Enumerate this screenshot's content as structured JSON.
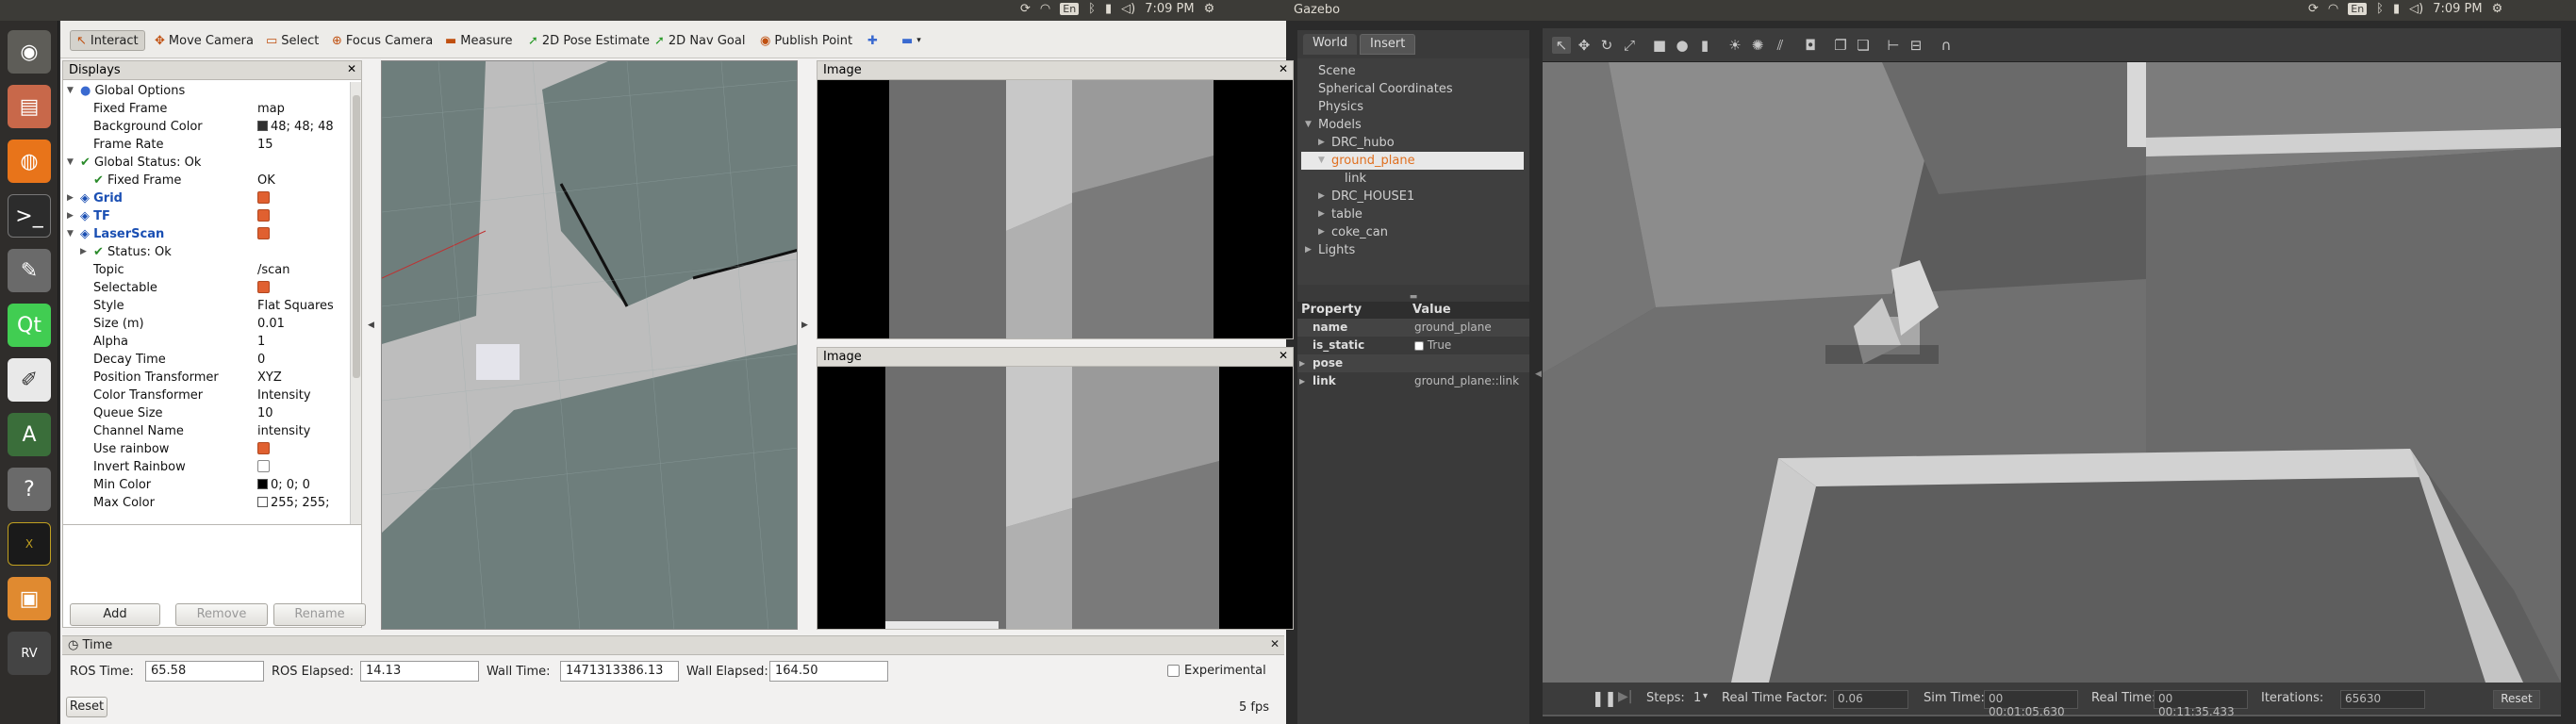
{
  "topbar": {
    "app_title": "Gazebo",
    "kb_left": "En",
    "time_left": "7:09 PM",
    "kb_right": "En",
    "time_right": "7:09 PM"
  },
  "rviz": {
    "toolbar": [
      {
        "label": "Interact",
        "icon": "interact-icon"
      },
      {
        "label": "Move Camera",
        "icon": "move-camera-icon"
      },
      {
        "label": "Select",
        "icon": "select-icon"
      },
      {
        "label": "Focus Camera",
        "icon": "focus-camera-icon"
      },
      {
        "label": "Measure",
        "icon": "measure-icon"
      },
      {
        "label": "2D Pose Estimate",
        "icon": "pose-estimate-icon"
      },
      {
        "label": "2D Nav Goal",
        "icon": "nav-goal-icon"
      },
      {
        "label": "Publish Point",
        "icon": "publish-point-icon"
      }
    ],
    "displays_title": "Displays",
    "tree": [
      {
        "label": "Global Options",
        "value": "",
        "indent": 1,
        "style": "",
        "exp": "▼"
      },
      {
        "label": "Fixed Frame",
        "value": "map",
        "indent": 2
      },
      {
        "label": "Background Color",
        "value": "48; 48; 48",
        "indent": 2,
        "swatch": "#303030"
      },
      {
        "label": "Frame Rate",
        "value": "15",
        "indent": 2
      },
      {
        "label": "Global Status: Ok",
        "value": "",
        "indent": 1,
        "exp": "▼",
        "check": true
      },
      {
        "label": "Fixed Frame",
        "value": "OK",
        "indent": 2,
        "check": true
      },
      {
        "label": "Grid",
        "value": "",
        "indent": 1,
        "exp": "▶",
        "style": "blue",
        "box": true
      },
      {
        "label": "TF",
        "value": "",
        "indent": 1,
        "exp": "▶",
        "style": "blue",
        "box": true
      },
      {
        "label": "LaserScan",
        "value": "",
        "indent": 1,
        "exp": "▼",
        "style": "blue",
        "box": true
      },
      {
        "label": "Status: Ok",
        "value": "",
        "indent": 2,
        "exp": "▶",
        "check": true
      },
      {
        "label": "Topic",
        "value": "/scan",
        "indent": 2
      },
      {
        "label": "Selectable",
        "value": "",
        "indent": 2,
        "box": true
      },
      {
        "label": "Style",
        "value": "Flat Squares",
        "indent": 2
      },
      {
        "label": "Size (m)",
        "value": "0.01",
        "indent": 2
      },
      {
        "label": "Alpha",
        "value": "1",
        "indent": 2
      },
      {
        "label": "Decay Time",
        "value": "0",
        "indent": 2
      },
      {
        "label": "Position Transformer",
        "value": "XYZ",
        "indent": 2
      },
      {
        "label": "Color Transformer",
        "value": "Intensity",
        "indent": 2
      },
      {
        "label": "Queue Size",
        "value": "10",
        "indent": 2
      },
      {
        "label": "Channel Name",
        "value": "intensity",
        "indent": 2
      },
      {
        "label": "Use rainbow",
        "value": "",
        "indent": 2,
        "box": true
      },
      {
        "label": "Invert Rainbow",
        "value": "",
        "indent": 2,
        "emptybox": true
      },
      {
        "label": "Min Color",
        "value": "0; 0; 0",
        "indent": 2,
        "swatch": "#000000"
      },
      {
        "label": "Max Color",
        "value": "255; 255;",
        "indent": 2,
        "swatch": "#ffffff"
      }
    ],
    "buttons": {
      "add": "Add",
      "remove": "Remove",
      "rename": "Rename"
    },
    "image_title_1": "Image",
    "image_title_2": "Image",
    "time": {
      "title": "Time",
      "ros_time_label": "ROS Time:",
      "ros_time": "65.58",
      "ros_elapsed_label": "ROS Elapsed:",
      "ros_elapsed": "14.13",
      "wall_time_label": "Wall Time:",
      "wall_time": "1471313386.13",
      "wall_elapsed_label": "Wall Elapsed:",
      "wall_elapsed": "164.50",
      "experimental": "Experimental",
      "reset": "Reset",
      "fps": "5 fps"
    }
  },
  "gazebo": {
    "tabs": {
      "world": "World",
      "insert": "Insert"
    },
    "tree": [
      {
        "label": "Scene",
        "indent": 1
      },
      {
        "label": "Spherical Coordinates",
        "indent": 1
      },
      {
        "label": "Physics",
        "indent": 1
      },
      {
        "label": "Models",
        "indent": 1,
        "exp": "▼"
      },
      {
        "label": "DRC_hubo",
        "indent": 2,
        "exp": "▶"
      },
      {
        "label": "ground_plane",
        "indent": 2,
        "exp": "▼",
        "selected": true
      },
      {
        "label": "link",
        "indent": 3
      },
      {
        "label": "DRC_HOUSE1",
        "indent": 2,
        "exp": "▶"
      },
      {
        "label": "table",
        "indent": 2,
        "exp": "▶"
      },
      {
        "label": "coke_can",
        "indent": 2,
        "exp": "▶"
      },
      {
        "label": "Lights",
        "indent": 1,
        "exp": "▶"
      }
    ],
    "props_header": {
      "property": "Property",
      "value": "Value"
    },
    "props": [
      {
        "name": "name",
        "value": "ground_plane"
      },
      {
        "name": "is_static",
        "value": "True",
        "check": true
      },
      {
        "name": "pose",
        "value": "",
        "exp": "▶"
      },
      {
        "name": "link",
        "value": "ground_plane::link",
        "exp": "▶"
      }
    ],
    "status": {
      "steps_label": "Steps:",
      "steps": "1",
      "rtf_label": "Real Time Factor:",
      "rtf": "0.06",
      "sim_label": "Sim Time:",
      "sim": "00 00:01:05.630",
      "real_label": "Real Time:",
      "real": "00 00:11:35.433",
      "iter_label": "Iterations:",
      "iter": "65630",
      "reset": "Reset"
    }
  }
}
